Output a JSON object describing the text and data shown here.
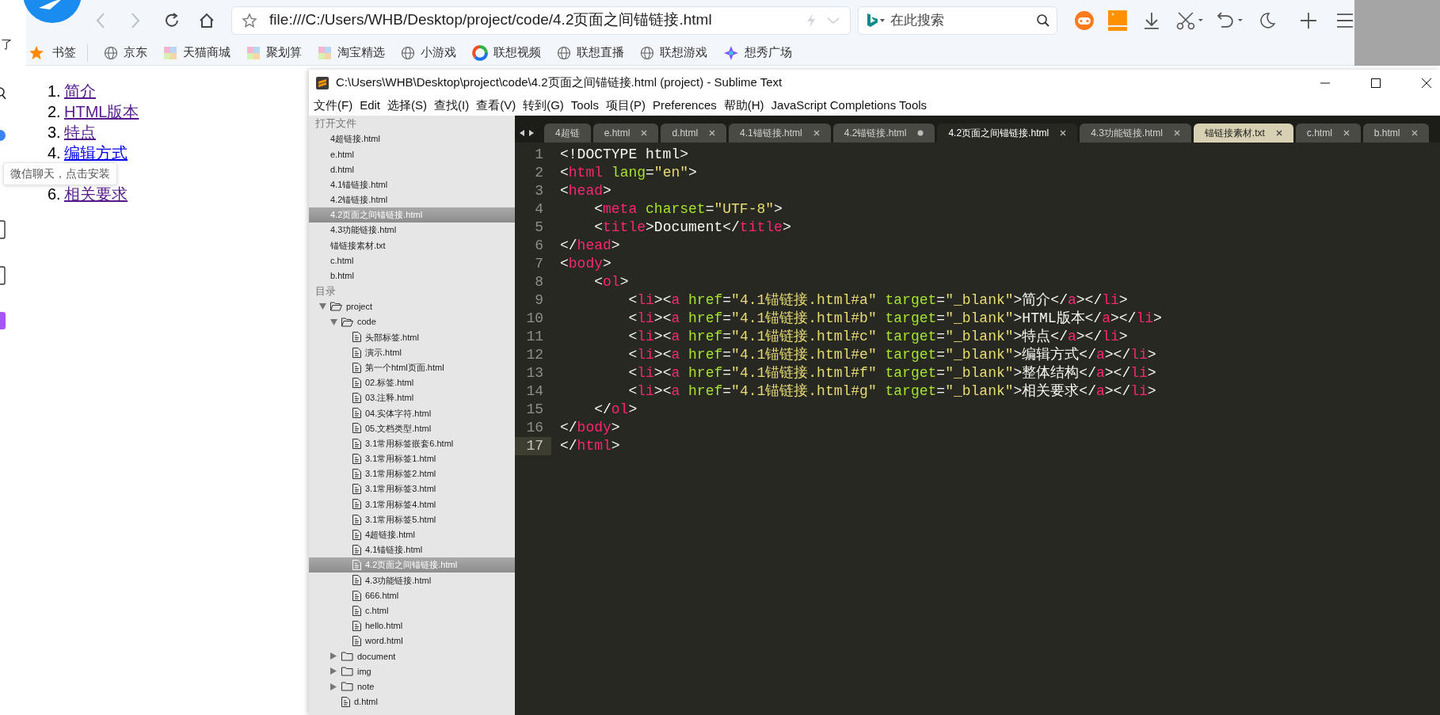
{
  "browser": {
    "url": "file:///C:/Users/WHB/Desktop/project/code/4.2页面之间锚链接.html",
    "search_placeholder": "在此搜索",
    "bookmarks_label": "书签",
    "bookmarks": [
      {
        "label": "京东",
        "kind": "globe"
      },
      {
        "label": "天猫商城",
        "kind": "mosaic"
      },
      {
        "label": "聚划算",
        "kind": "mosaic"
      },
      {
        "label": "淘宝精选",
        "kind": "mosaic"
      },
      {
        "label": "小游戏",
        "kind": "globe"
      },
      {
        "label": "联想视频",
        "kind": "ring"
      },
      {
        "label": "联想直播",
        "kind": "globe"
      },
      {
        "label": "联想游戏",
        "kind": "globe"
      },
      {
        "label": "想秀广场",
        "kind": "sparkle"
      }
    ]
  },
  "page": {
    "side_char": "了",
    "items": [
      {
        "kind": "link",
        "number": "1.",
        "label": "简介",
        "visited": true
      },
      {
        "kind": "link",
        "number": "2.",
        "label": "HTML版本",
        "visited": true
      },
      {
        "kind": "link",
        "number": "3.",
        "label": "特点",
        "visited": true
      },
      {
        "kind": "link",
        "number": "4.",
        "label": "编辑方式",
        "visited": false
      },
      {
        "kind": "tooltip",
        "text": "微信聊天，点击安装"
      },
      {
        "kind": "link",
        "number": "6.",
        "label": "相关要求",
        "visited": true
      }
    ]
  },
  "editor": {
    "title": "C:\\Users\\WHB\\Desktop\\project\\code\\4.2页面之间锚链接.html (project) - Sublime Text",
    "menu": [
      "文件(F)",
      "Edit",
      "选择(S)",
      "查找(I)",
      "查看(V)",
      "转到(G)",
      "Tools",
      "项目(P)",
      "Preferences",
      "帮助(H)",
      "JavaScript Completions Tools"
    ],
    "sidebar": {
      "open_files_label": "打开文件",
      "open_files": [
        {
          "label": "4超链接.html",
          "selected": false
        },
        {
          "label": "e.html",
          "selected": false
        },
        {
          "label": "d.html",
          "selected": false
        },
        {
          "label": "4.1锚链接.html",
          "selected": false
        },
        {
          "label": "4.2锚链接.html",
          "selected": false
        },
        {
          "label": "4.2页面之间锚链接.html",
          "selected": true
        },
        {
          "label": "4.3功能链接.html",
          "selected": false
        },
        {
          "label": "锚链接素材.txt",
          "selected": false
        },
        {
          "label": "c.html",
          "selected": false
        },
        {
          "label": "b.html",
          "selected": false
        }
      ],
      "folders_label": "目录",
      "tree": [
        {
          "label": "project",
          "kind": "folder",
          "expanded": true,
          "selected": false,
          "children": [
            {
              "label": "code",
              "kind": "folder",
              "expanded": true,
              "selected": false,
              "children": [
                {
                  "label": "头部标签.html",
                  "kind": "file",
                  "selected": false
                },
                {
                  "label": "演示.html",
                  "kind": "file",
                  "selected": false
                },
                {
                  "label": "第一个html页面.html",
                  "kind": "file",
                  "selected": false
                },
                {
                  "label": "02.标签.html",
                  "kind": "file",
                  "selected": false
                },
                {
                  "label": "03.注释.html",
                  "kind": "file",
                  "selected": false
                },
                {
                  "label": "04.实体字符.html",
                  "kind": "file",
                  "selected": false
                },
                {
                  "label": "05.文档类型.html",
                  "kind": "file",
                  "selected": false
                },
                {
                  "label": "3.1常用标签嵌套6.html",
                  "kind": "file",
                  "selected": false
                },
                {
                  "label": "3.1常用标签1.html",
                  "kind": "file",
                  "selected": false
                },
                {
                  "label": "3.1常用标签2.html",
                  "kind": "file",
                  "selected": false
                },
                {
                  "label": "3.1常用标签3.html",
                  "kind": "file",
                  "selected": false
                },
                {
                  "label": "3.1常用标签4.html",
                  "kind": "file",
                  "selected": false
                },
                {
                  "label": "3.1常用标签5.html",
                  "kind": "file",
                  "selected": false
                },
                {
                  "label": "4超链接.html",
                  "kind": "file",
                  "selected": false
                },
                {
                  "label": "4.1锚链接.html",
                  "kind": "file",
                  "selected": false
                },
                {
                  "label": "4.2页面之间锚链接.html",
                  "kind": "file",
                  "selected": true
                },
                {
                  "label": "4.3功能链接.html",
                  "kind": "file",
                  "selected": false
                },
                {
                  "label": "666.html",
                  "kind": "file",
                  "selected": false
                },
                {
                  "label": "c.html",
                  "kind": "file",
                  "selected": false
                },
                {
                  "label": "hello.html",
                  "kind": "file",
                  "selected": false
                },
                {
                  "label": "word.html",
                  "kind": "file",
                  "selected": false
                }
              ]
            },
            {
              "label": "document",
              "kind": "folder",
              "expanded": false,
              "selected": false
            },
            {
              "label": "img",
              "kind": "folder",
              "expanded": false,
              "selected": false
            },
            {
              "label": "note",
              "kind": "folder",
              "expanded": false,
              "selected": false
            },
            {
              "label": "d.html",
              "kind": "file",
              "selected": false
            }
          ]
        }
      ]
    },
    "tabs": [
      {
        "label": "4超链",
        "selected": false,
        "highlighted": false,
        "modified": false,
        "close_button": false
      },
      {
        "label": "e.html",
        "selected": false,
        "highlighted": false,
        "modified": false,
        "close_button": true
      },
      {
        "label": "d.html",
        "selected": false,
        "highlighted": false,
        "modified": false,
        "close_button": true
      },
      {
        "label": "4.1锚链接.html",
        "selected": false,
        "highlighted": false,
        "modified": false,
        "close_button": true
      },
      {
        "label": "4.2锚链接.html",
        "selected": false,
        "highlighted": false,
        "modified": true,
        "close_button": false
      },
      {
        "label": "4.2页面之间锚链接.html",
        "selected": true,
        "highlighted": false,
        "modified": false,
        "close_button": true
      },
      {
        "label": "4.3功能链接.html",
        "selected": false,
        "highlighted": false,
        "modified": false,
        "close_button": true
      },
      {
        "label": "锚链接素材.txt",
        "selected": false,
        "highlighted": true,
        "modified": false,
        "close_button": true
      },
      {
        "label": "c.html",
        "selected": false,
        "highlighted": false,
        "modified": false,
        "close_button": true
      },
      {
        "label": "b.html",
        "selected": false,
        "highlighted": false,
        "modified": false,
        "close_button": true
      }
    ],
    "code_lines": [
      {
        "number": "1",
        "current": false,
        "tokens": [
          {
            "kind": "plain",
            "text": "<!DOCTYPE html>"
          }
        ]
      },
      {
        "number": "2",
        "current": false,
        "tokens": [
          {
            "kind": "plain",
            "text": "<"
          },
          {
            "kind": "tag",
            "text": "html"
          },
          {
            "kind": "attr",
            "text": " lang"
          },
          {
            "kind": "plain",
            "text": "="
          },
          {
            "kind": "string",
            "text": "\"en\""
          },
          {
            "kind": "plain",
            "text": ">"
          }
        ]
      },
      {
        "number": "3",
        "current": false,
        "tokens": [
          {
            "kind": "plain",
            "text": "<"
          },
          {
            "kind": "tag",
            "text": "head"
          },
          {
            "kind": "plain",
            "text": ">"
          }
        ]
      },
      {
        "number": "4",
        "current": false,
        "tokens": [
          {
            "kind": "plain",
            "text": "    <"
          },
          {
            "kind": "tag",
            "text": "meta"
          },
          {
            "kind": "attr",
            "text": " charset"
          },
          {
            "kind": "plain",
            "text": "="
          },
          {
            "kind": "string",
            "text": "\"UTF-8\""
          },
          {
            "kind": "plain",
            "text": ">"
          }
        ]
      },
      {
        "number": "5",
        "current": false,
        "tokens": [
          {
            "kind": "plain",
            "text": "    <"
          },
          {
            "kind": "tag",
            "text": "title"
          },
          {
            "kind": "plain",
            "text": ">Document</"
          },
          {
            "kind": "tag",
            "text": "title"
          },
          {
            "kind": "plain",
            "text": ">"
          }
        ]
      },
      {
        "number": "6",
        "current": false,
        "tokens": [
          {
            "kind": "plain",
            "text": "</"
          },
          {
            "kind": "tag",
            "text": "head"
          },
          {
            "kind": "plain",
            "text": ">"
          }
        ]
      },
      {
        "number": "7",
        "current": false,
        "tokens": [
          {
            "kind": "plain",
            "text": "<"
          },
          {
            "kind": "tag",
            "text": "body"
          },
          {
            "kind": "plain",
            "text": ">"
          }
        ]
      },
      {
        "number": "8",
        "current": false,
        "tokens": [
          {
            "kind": "plain",
            "text": "    <"
          },
          {
            "kind": "tag",
            "text": "ol"
          },
          {
            "kind": "plain",
            "text": ">"
          }
        ]
      },
      {
        "number": "9",
        "current": false,
        "tokens": [
          {
            "kind": "plain",
            "text": "        <"
          },
          {
            "kind": "tag",
            "text": "li"
          },
          {
            "kind": "plain",
            "text": "><"
          },
          {
            "kind": "tag",
            "text": "a"
          },
          {
            "kind": "attr",
            "text": " href"
          },
          {
            "kind": "plain",
            "text": "="
          },
          {
            "kind": "string",
            "text": "\"4.1锚链接.html#a\""
          },
          {
            "kind": "attr",
            "text": " target"
          },
          {
            "kind": "plain",
            "text": "="
          },
          {
            "kind": "string",
            "text": "\"_blank\""
          },
          {
            "kind": "plain",
            "text": ">简介</"
          },
          {
            "kind": "tag",
            "text": "a"
          },
          {
            "kind": "plain",
            "text": "></"
          },
          {
            "kind": "tag",
            "text": "li"
          },
          {
            "kind": "plain",
            "text": ">"
          }
        ]
      },
      {
        "number": "10",
        "current": false,
        "tokens": [
          {
            "kind": "plain",
            "text": "        <"
          },
          {
            "kind": "tag",
            "text": "li"
          },
          {
            "kind": "plain",
            "text": "><"
          },
          {
            "kind": "tag",
            "text": "a"
          },
          {
            "kind": "attr",
            "text": " href"
          },
          {
            "kind": "plain",
            "text": "="
          },
          {
            "kind": "string",
            "text": "\"4.1锚链接.html#b\""
          },
          {
            "kind": "attr",
            "text": " target"
          },
          {
            "kind": "plain",
            "text": "="
          },
          {
            "kind": "string",
            "text": "\"_blank\""
          },
          {
            "kind": "plain",
            "text": ">HTML版本</"
          },
          {
            "kind": "tag",
            "text": "a"
          },
          {
            "kind": "plain",
            "text": "></"
          },
          {
            "kind": "tag",
            "text": "li"
          },
          {
            "kind": "plain",
            "text": ">"
          }
        ]
      },
      {
        "number": "11",
        "current": false,
        "tokens": [
          {
            "kind": "plain",
            "text": "        <"
          },
          {
            "kind": "tag",
            "text": "li"
          },
          {
            "kind": "plain",
            "text": "><"
          },
          {
            "kind": "tag",
            "text": "a"
          },
          {
            "kind": "attr",
            "text": " href"
          },
          {
            "kind": "plain",
            "text": "="
          },
          {
            "kind": "string",
            "text": "\"4.1锚链接.html#c\""
          },
          {
            "kind": "attr",
            "text": " target"
          },
          {
            "kind": "plain",
            "text": "="
          },
          {
            "kind": "string",
            "text": "\"_blank\""
          },
          {
            "kind": "plain",
            "text": ">特点</"
          },
          {
            "kind": "tag",
            "text": "a"
          },
          {
            "kind": "plain",
            "text": "></"
          },
          {
            "kind": "tag",
            "text": "li"
          },
          {
            "kind": "plain",
            "text": ">"
          }
        ]
      },
      {
        "number": "12",
        "current": false,
        "tokens": [
          {
            "kind": "plain",
            "text": "        <"
          },
          {
            "kind": "tag",
            "text": "li"
          },
          {
            "kind": "plain",
            "text": "><"
          },
          {
            "kind": "tag",
            "text": "a"
          },
          {
            "kind": "attr",
            "text": " href"
          },
          {
            "kind": "plain",
            "text": "="
          },
          {
            "kind": "string",
            "text": "\"4.1锚链接.html#e\""
          },
          {
            "kind": "attr",
            "text": " target"
          },
          {
            "kind": "plain",
            "text": "="
          },
          {
            "kind": "string",
            "text": "\"_blank\""
          },
          {
            "kind": "plain",
            "text": ">编辑方式</"
          },
          {
            "kind": "tag",
            "text": "a"
          },
          {
            "kind": "plain",
            "text": "></"
          },
          {
            "kind": "tag",
            "text": "li"
          },
          {
            "kind": "plain",
            "text": ">"
          }
        ]
      },
      {
        "number": "13",
        "current": false,
        "tokens": [
          {
            "kind": "plain",
            "text": "        <"
          },
          {
            "kind": "tag",
            "text": "li"
          },
          {
            "kind": "plain",
            "text": "><"
          },
          {
            "kind": "tag",
            "text": "a"
          },
          {
            "kind": "attr",
            "text": " href"
          },
          {
            "kind": "plain",
            "text": "="
          },
          {
            "kind": "string",
            "text": "\"4.1锚链接.html#f\""
          },
          {
            "kind": "attr",
            "text": " target"
          },
          {
            "kind": "plain",
            "text": "="
          },
          {
            "kind": "string",
            "text": "\"_blank\""
          },
          {
            "kind": "plain",
            "text": ">整体结构</"
          },
          {
            "kind": "tag",
            "text": "a"
          },
          {
            "kind": "plain",
            "text": "></"
          },
          {
            "kind": "tag",
            "text": "li"
          },
          {
            "kind": "plain",
            "text": ">"
          }
        ]
      },
      {
        "number": "14",
        "current": false,
        "tokens": [
          {
            "kind": "plain",
            "text": "        <"
          },
          {
            "kind": "tag",
            "text": "li"
          },
          {
            "kind": "plain",
            "text": "><"
          },
          {
            "kind": "tag",
            "text": "a"
          },
          {
            "kind": "attr",
            "text": " href"
          },
          {
            "kind": "plain",
            "text": "="
          },
          {
            "kind": "string",
            "text": "\"4.1锚链接.html#g\""
          },
          {
            "kind": "attr",
            "text": " target"
          },
          {
            "kind": "plain",
            "text": "="
          },
          {
            "kind": "string",
            "text": "\"_blank\""
          },
          {
            "kind": "plain",
            "text": ">相关要求</"
          },
          {
            "kind": "tag",
            "text": "a"
          },
          {
            "kind": "plain",
            "text": "></"
          },
          {
            "kind": "tag",
            "text": "li"
          },
          {
            "kind": "plain",
            "text": ">"
          }
        ]
      },
      {
        "number": "15",
        "current": false,
        "tokens": [
          {
            "kind": "plain",
            "text": "    </"
          },
          {
            "kind": "tag",
            "text": "ol"
          },
          {
            "kind": "plain",
            "text": ">"
          }
        ]
      },
      {
        "number": "16",
        "current": false,
        "tokens": [
          {
            "kind": "plain",
            "text": "</"
          },
          {
            "kind": "tag",
            "text": "body"
          },
          {
            "kind": "plain",
            "text": ">"
          }
        ]
      },
      {
        "number": "17",
        "current": true,
        "tokens": [
          {
            "kind": "plain",
            "text": "</"
          },
          {
            "kind": "tag",
            "text": "html"
          },
          {
            "kind": "plain",
            "text": ">"
          }
        ]
      }
    ]
  }
}
